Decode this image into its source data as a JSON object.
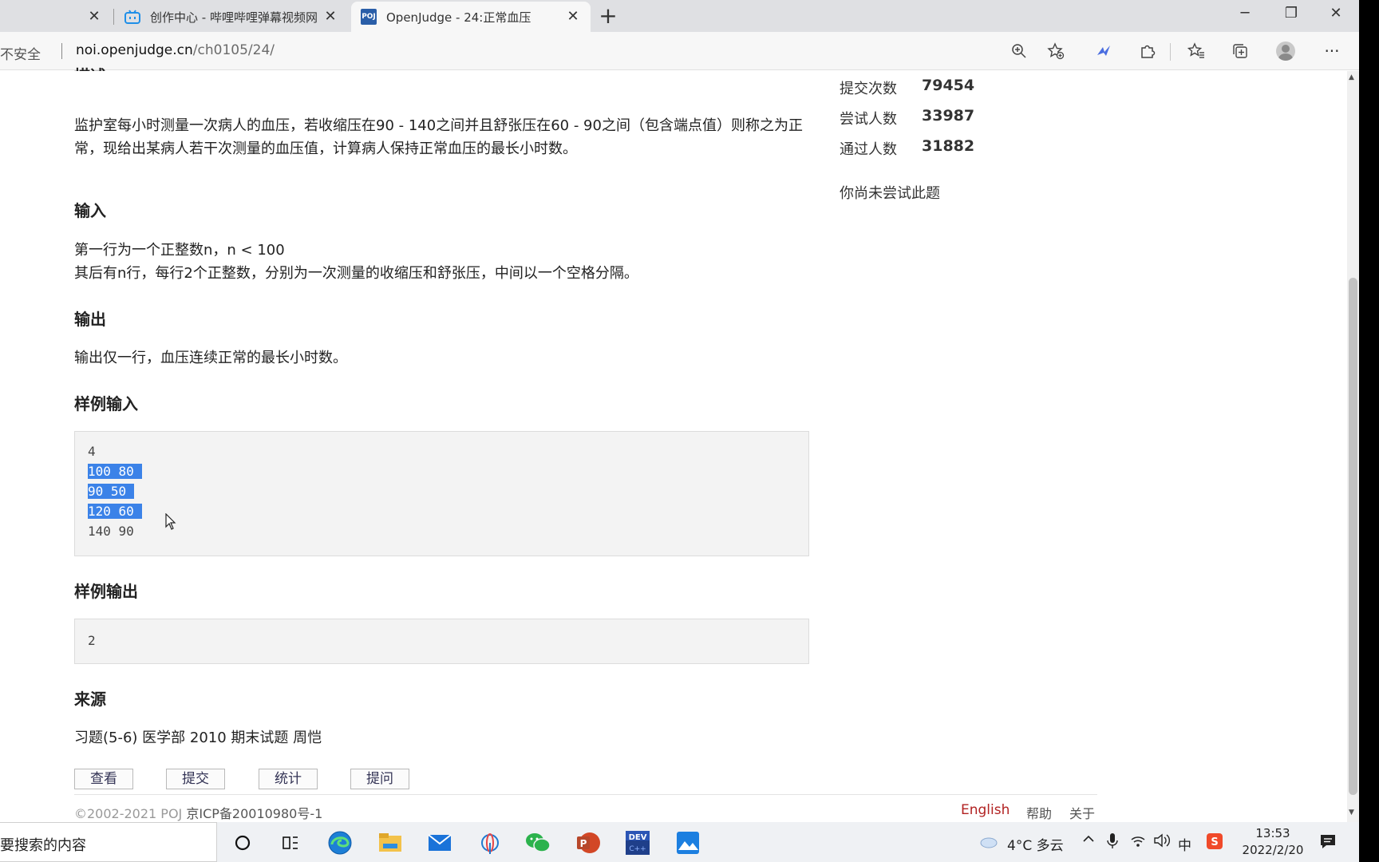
{
  "tabs": [
    {
      "title": "创作中心 - 哔哩哔哩弹幕视频网",
      "active": false
    },
    {
      "title": "OpenJudge - 24:正常血压",
      "favicon": "POJ",
      "active": true
    }
  ],
  "address_bar": {
    "security": "不安全",
    "host": "noi.openjudge.cn",
    "path": "/ch0105/24/"
  },
  "problem": {
    "description": "监护室每小时测量一次病人的血压，若收缩压在90 - 140之间并且舒张压在60 - 90之间（包含端点值）则称之为正常，现给出某病人若干次测量的血压值，计算病人保持正常血压的最长小时数。",
    "input_heading": "输入",
    "input_lines": [
      "第一行为一个正整数n，n < 100",
      "其后有n行，每行2个正整数，分别为一次测量的收缩压和舒张压，中间以一个空格分隔。"
    ],
    "output_heading": "输出",
    "output_text": "输出仅一行，血压连续正常的最长小时数。",
    "sample_input_heading": "样例输入",
    "sample_input": [
      {
        "text": "4",
        "selected": false
      },
      {
        "text": "100 80",
        "selected": true
      },
      {
        "text": "90 50",
        "selected": true
      },
      {
        "text": "120 60",
        "selected": true
      },
      {
        "text": "140 90",
        "selected": false
      }
    ],
    "sample_output_heading": "样例输出",
    "sample_output": "2",
    "source_heading": "来源",
    "source_text": "习题(5-6) 医学部 2010 期末试题 周恺"
  },
  "actions": [
    "查看",
    "提交",
    "统计",
    "提问"
  ],
  "stats": [
    {
      "label": "提交次数",
      "value": "79454"
    },
    {
      "label": "尝试人数",
      "value": "33987"
    },
    {
      "label": "通过人数",
      "value": "31882"
    }
  ],
  "status_note": "你尚未尝试此题",
  "footer": {
    "copyright": "©2002-2021 POJ",
    "icp": "京ICP备20010980号-1",
    "links": [
      "English",
      "帮助",
      "关于"
    ]
  },
  "taskbar": {
    "search_placeholder": "你要搜索的内容",
    "weather": "4°C 多云",
    "ime": "中",
    "time": "13:53",
    "date": "2022/2/20"
  },
  "accent_color": "#3b82e8"
}
